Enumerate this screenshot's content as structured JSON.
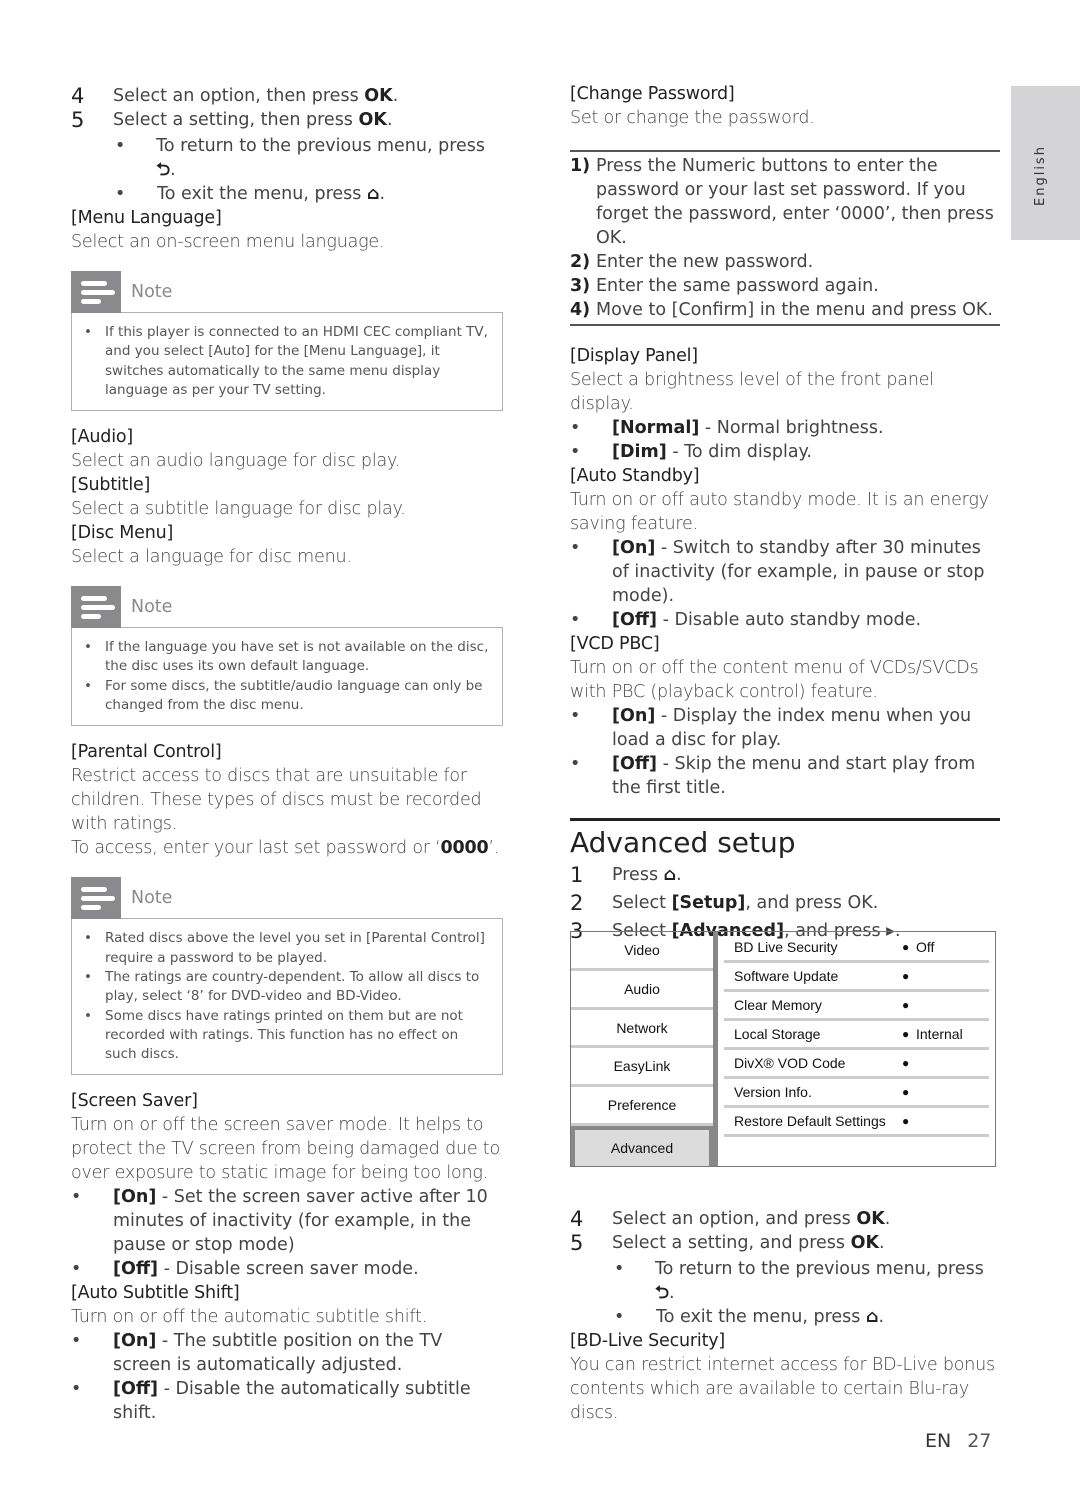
{
  "side_tab": {
    "label": "English"
  },
  "left": {
    "steps": [
      {
        "num": "4",
        "pre": "Select an option, then press ",
        "key": "OK",
        "post": "."
      },
      {
        "num": "5",
        "pre": "Select a setting, then press ",
        "key": "OK",
        "post": "."
      }
    ],
    "substeps": [
      {
        "text": "To return to the previous menu, press ",
        "icon": "back-icon",
        "glyph": "⮌"
      },
      {
        "text": "To exit the menu, press ",
        "icon": "home-icon",
        "glyph": "⌂"
      }
    ],
    "menu_language": {
      "title": "[Menu Language]",
      "desc": "Select an on-screen menu language."
    },
    "note1": {
      "title": "Note",
      "items": [
        "If this player is connected to an HDMI CEC compliant TV, and you select [Auto] for the [Menu Language], it switches automatically to the same menu display language as per your TV setting."
      ]
    },
    "audio": {
      "title": "[Audio]",
      "desc": "Select an audio language for disc play."
    },
    "subtitle": {
      "title": "[Subtitle]",
      "desc": "Select a subtitle language for disc play."
    },
    "disc_menu": {
      "title": "[Disc Menu]",
      "desc": "Select a language for disc menu."
    },
    "note2": {
      "title": "Note",
      "items": [
        "If the language you have set is not available on the disc, the disc uses its own default language.",
        "For some discs, the subtitle/audio language can only be changed from the disc menu."
      ]
    },
    "parental": {
      "title": "[Parental Control]",
      "desc": "Restrict access to discs that are unsuitable for children. These types of discs must be recorded with ratings.",
      "access_pre": "To access, enter your last set password or ‘",
      "access_code": "0000",
      "access_post": "’."
    },
    "note3": {
      "title": "Note",
      "items": [
        "Rated discs above the level you set in [Parental Control] require a password to be played.",
        "The ratings are country-dependent. To allow all discs to play, select ‘8’ for DVD-video and BD-Video.",
        "Some discs have ratings printed on them but are not recorded with ratings. This function has no effect on such discs."
      ]
    },
    "screen_saver": {
      "title": "[Screen Saver]",
      "desc": "Turn on or off the screen saver mode. It helps to protect the TV screen from being damaged due to over exposure to static image for being too long.",
      "options": [
        {
          "key": "[On]",
          "text": " - Set the screen saver active after 10 minutes of inactivity (for example, in the pause or stop mode)"
        },
        {
          "key": "[Off]",
          "text": " - Disable screen saver mode."
        }
      ]
    },
    "auto_subtitle": {
      "title": "[Auto Subtitle Shift]",
      "desc": "Turn on or off the automatic subtitle shift.",
      "options": [
        {
          "key": "[On]",
          "text": " - The subtitle position on the TV screen is automatically adjusted."
        },
        {
          "key": "[Off]",
          "text": " - Disable the automatically subtitle shift."
        }
      ]
    }
  },
  "right": {
    "change_password": {
      "title": "[Change Password]",
      "desc": "Set or change the password.",
      "steps": [
        {
          "num": "1)",
          "text": "Press the Numeric buttons to enter the password or your last set password. If you forget the password, enter ‘0000’, then press OK."
        },
        {
          "num": "2)",
          "text": "Enter the new password."
        },
        {
          "num": "3)",
          "text": "Enter the same password again."
        },
        {
          "num": "4)",
          "text": "Move to [Confirm] in the menu and press OK."
        }
      ]
    },
    "display_panel": {
      "title": "[Display Panel]",
      "desc": "Select a brightness level of the front panel display.",
      "options": [
        {
          "key": "[Normal]",
          "text": " - Normal brightness."
        },
        {
          "key": "[Dim]",
          "text": " - To dim display."
        }
      ]
    },
    "auto_standby": {
      "title": "[Auto Standby]",
      "desc": "Turn on or off auto standby mode. It is an energy saving feature.",
      "options": [
        {
          "key": "[On]",
          "text": " - Switch to standby after 30 minutes of inactivity (for example, in pause or stop mode)."
        },
        {
          "key": "[Off]",
          "text": " - Disable auto standby mode."
        }
      ]
    },
    "vcd_pbc": {
      "title": "[VCD PBC]",
      "desc": "Turn on or off the content menu of VCDs/SVCDs with PBC (playback control) feature.",
      "options": [
        {
          "key": "[On]",
          "text": " - Display the index menu when you load a disc for play."
        },
        {
          "key": "[Off]",
          "text": " - Skip the menu and start play from the first title."
        }
      ]
    },
    "advanced": {
      "title": "Advanced setup",
      "steps": [
        {
          "num": "1",
          "pre": "Press ",
          "key": "⌂",
          "post": "."
        },
        {
          "num": "2",
          "pre": "Select ",
          "key": "[Setup]",
          "post": ", and press OK."
        },
        {
          "num": "3",
          "pre": "Select ",
          "key": "[Advanced]",
          "post": ", and press ▸."
        }
      ]
    },
    "menu": {
      "left_items": [
        "Video",
        "Audio",
        "Network",
        "EasyLink",
        "Preference",
        "Advanced"
      ],
      "selected": "Advanced",
      "right_items": [
        {
          "label": "BD Live Security",
          "value": "Off"
        },
        {
          "label": "Software Update",
          "value": ""
        },
        {
          "label": "Clear Memory",
          "value": ""
        },
        {
          "label": "Local Storage",
          "value": "Internal"
        },
        {
          "label": "DivX® VOD Code",
          "value": ""
        },
        {
          "label": "Version Info.",
          "value": ""
        },
        {
          "label": "Restore Default Settings",
          "value": ""
        }
      ]
    },
    "steps_after": [
      {
        "num": "4",
        "pre": "Select an option, and press ",
        "key": "OK",
        "post": "."
      },
      {
        "num": "5",
        "pre": "Select a setting, and press ",
        "key": "OK",
        "post": "."
      }
    ],
    "substeps_after": [
      {
        "text": "To return to the previous menu, press ",
        "glyph": "⮌"
      },
      {
        "text": "To exit the menu, press ",
        "glyph": "⌂"
      }
    ],
    "bd_live": {
      "title": "[BD-Live Security]",
      "desc": "You can restrict internet access for BD-Live bonus contents which are available to certain Blu-ray discs."
    }
  },
  "footer": {
    "lang": "EN",
    "page": "27"
  }
}
